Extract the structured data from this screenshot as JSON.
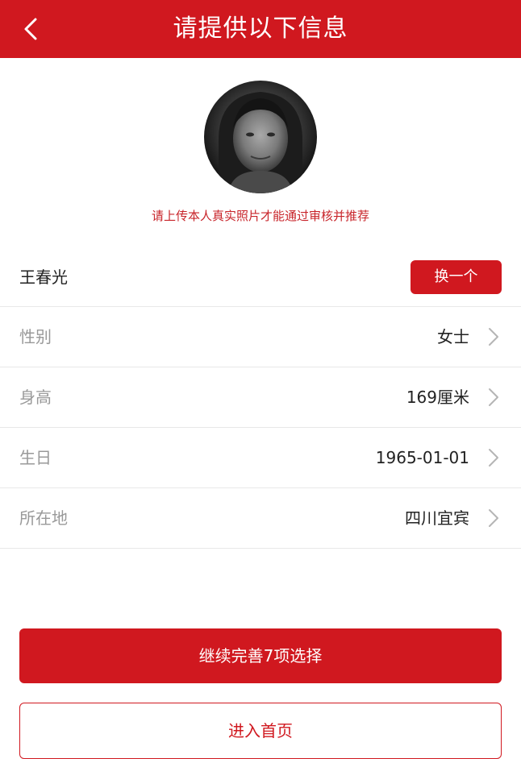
{
  "header": {
    "title": "请提供以下信息",
    "back_icon": "chevron-left-icon"
  },
  "profile": {
    "hint": "请上传本人真实照片才能通过审核并推荐",
    "name": "王春光",
    "change_label": "换一个"
  },
  "fields": [
    {
      "label": "性别",
      "value": "女士"
    },
    {
      "label": "身高",
      "value": "169厘米"
    },
    {
      "label": "生日",
      "value": "1965-01-01"
    },
    {
      "label": "所在地",
      "value": "四川宜宾"
    }
  ],
  "actions": {
    "primary_label": "继续完善7项选择",
    "secondary_label": "进入首页"
  },
  "colors": {
    "brand": "#d0181f",
    "label_gray": "#999999",
    "divider": "#e8e8e8"
  }
}
